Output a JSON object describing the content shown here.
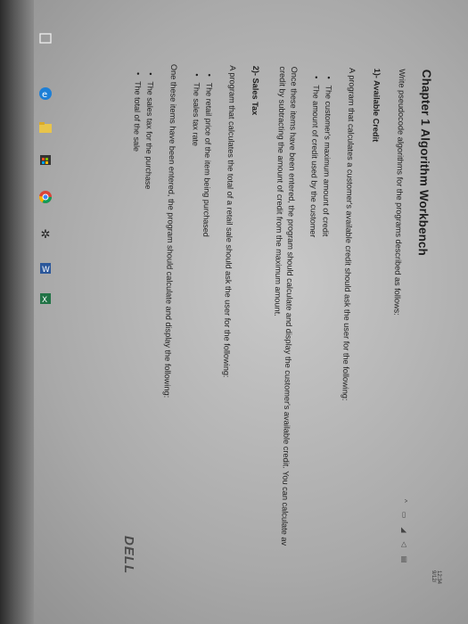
{
  "document": {
    "title": "Chapter 1 Algorithm Workbench",
    "intro": "Write pseudocode algorithms for the programs described as follows:",
    "section1": {
      "heading": "1)- Available Credit",
      "description": "A program that calculates a customer's available credit should ask the user for the following:",
      "items": [
        "The customer's maximum amount of credit",
        "The amount of credit used by the customer"
      ],
      "after_line1": "Once these items have been entered, the program should calculate and display the customer's available credit. You can calculate av",
      "after_line2": "credit by subtracting the amount of credit from the maximum amount."
    },
    "section2": {
      "heading": "2)- Sales Tax",
      "description": "A program that calculates the total of a retail sale should ask the user for the following:",
      "items": [
        "The retail price of the item being purchased",
        "The sales tax rate"
      ],
      "after": "One these items have been entered, the program should calculate and display the following:",
      "items2": [
        "The sales tax for the purchase",
        "The total of the sale"
      ]
    }
  },
  "taskbar": {
    "icons": [
      "tablet-mode-icon",
      "edge-browser-icon",
      "file-explorer-icon",
      "store-icon",
      "chrome-icon",
      "settings-gear-icon",
      "word-icon",
      "excel-icon"
    ],
    "brand": "DELL",
    "clock_time": "12:34",
    "clock_date": "9/12/"
  }
}
